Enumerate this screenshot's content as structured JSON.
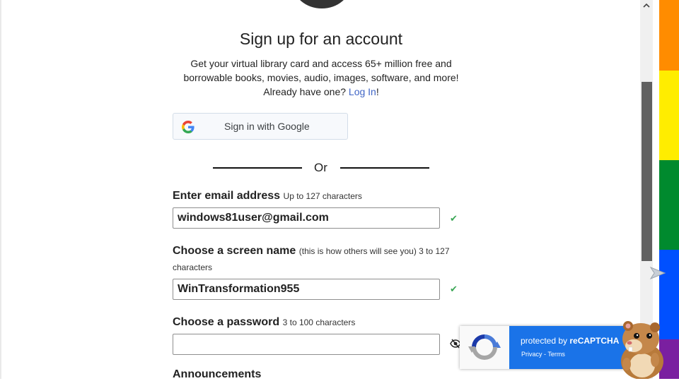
{
  "page": {
    "title": "Sign up for an account",
    "intro_line1": "Get your virtual library card and access 65+ million free and",
    "intro_line2": "borrowable books, movies, audio, images, software, and more!",
    "already_text": "Already have one? ",
    "login_link": "Log In",
    "login_suffix": "!"
  },
  "google_button": {
    "label": "Sign in with Google",
    "icon": "google-g-icon"
  },
  "divider": {
    "text": "Or"
  },
  "email": {
    "label": "Enter email address",
    "hint": "Up to 127 characters",
    "value": "windows81user@gmail.com",
    "status": "✔"
  },
  "screen_name": {
    "label": "Choose a screen name",
    "hint": "(this is how others will see you) 3 to 127",
    "hint_cont": "characters",
    "value": "WinTransformation955",
    "status": "✔"
  },
  "password": {
    "label": "Choose a password",
    "hint": "3 to 100 characters",
    "value": "",
    "toggle_icon": "eye-slash-icon"
  },
  "announcements": {
    "label": "Announcements"
  },
  "recaptcha": {
    "protected_by": "protected by ",
    "brand": "reCAPTCHA",
    "privacy": "Privacy",
    "separator": " - ",
    "terms": "Terms"
  },
  "colors": {
    "accent_link": "#4166c6",
    "check_green": "#3aa655",
    "recaptcha_blue": "#1a73e8",
    "rainbow": [
      "#ff8c00",
      "#ffed00",
      "#008a2e",
      "#0050ff",
      "#7a1fa0"
    ]
  }
}
